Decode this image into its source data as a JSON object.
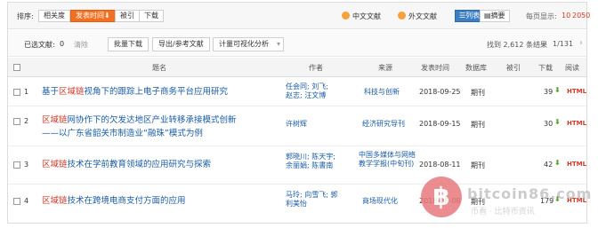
{
  "sort": {
    "label": "排序:",
    "options": [
      "相关度",
      "发表时间⬇",
      "被引",
      "下载"
    ],
    "active_index": 1
  },
  "lang": {
    "chinese": "中文文献",
    "foreign": "外文文献"
  },
  "view": {
    "list": "列表",
    "abstract": "摘要"
  },
  "page_size": {
    "label": "每页显示:",
    "options": [
      "10",
      "20",
      "50"
    ]
  },
  "toolbar": {
    "selected_label": "已选文献:",
    "selected_count": "0",
    "clear": "清除",
    "batch_download": "批量下载",
    "export": "导出/参考文献",
    "analysis": "计量可视化分析",
    "result_text": "找到 2,612 条结果",
    "page_indicator": "1/131"
  },
  "columns": {
    "title": "题名",
    "author": "作者",
    "source": "来源",
    "date": "发表时间",
    "db": "数据库",
    "cited": "被引",
    "downloads": "下载",
    "read": "阅读"
  },
  "rows": [
    {
      "num": "1",
      "title_pre": "基于",
      "title_hl": "区域链",
      "title_post": "视角下的跟踪上电子商务平台应用研究",
      "title_line2": "",
      "author": "任会同; 刘飞; 赵志; 汪文博",
      "source": "科技与创新",
      "date": "2018-09-25",
      "db": "期刊",
      "downloads": "39",
      "html": "HTML"
    },
    {
      "num": "2",
      "title_pre": "",
      "title_hl": "区域链",
      "title_post": "网协作下的欠发达地区产业转移承接模式创新",
      "title_line2": "——以广东省韶关市制造业“融珠”模式为例",
      "author": "许树辉",
      "source": "经济研究导刊",
      "date": "2018-09-15",
      "db": "期刊",
      "downloads": "30",
      "html": "HTML"
    },
    {
      "num": "3",
      "title_pre": "",
      "title_hl": "区域链",
      "title_post": "技术在学前教育领域的应用研究与探索",
      "title_line2": "",
      "author": "郭晓川; 陈天宇; 余丽娟; 陈書南",
      "source": "中国多媒体与网络教学学报(中旬刊)",
      "date": "2018-08-11",
      "db": "期刊",
      "downloads": "42",
      "html": "HTML"
    },
    {
      "num": "4",
      "title_pre": "",
      "title_hl": "区域链",
      "title_post": "技术在跨境电商支付方面的应用",
      "title_line2": "",
      "author": "马玲; 向雪飞; 郭利美怡",
      "source": "商场现代化",
      "date": "2018-08-08",
      "db": "期刊",
      "downloads": "179",
      "html": "HTML"
    }
  ],
  "watermark": {
    "coin": "฿",
    "text": "bitcoin86.com",
    "text2": "币看 · 比特币资讯"
  },
  "colors": {
    "accent": "#f37021",
    "link": "#1a5ba6",
    "highlight": "#d23a2a",
    "download": "#5aa02c"
  }
}
